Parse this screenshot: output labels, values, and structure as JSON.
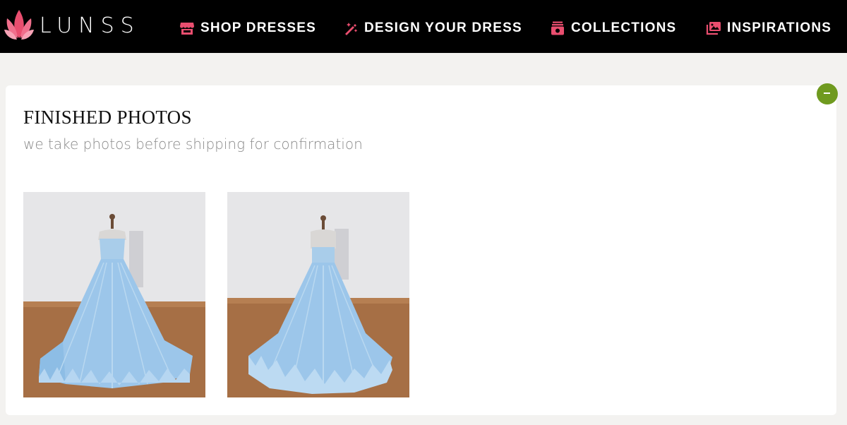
{
  "brand": {
    "name": "LUNSS",
    "logo_icon": "lotus-icon",
    "accent_color": "#e94e6f"
  },
  "nav": {
    "items": [
      {
        "label": "SHOP DRESSES",
        "icon": "store-icon"
      },
      {
        "label": "DESIGN YOUR DRESS",
        "icon": "magic-wand-icon"
      },
      {
        "label": "COLLECTIONS",
        "icon": "collection-box-icon"
      },
      {
        "label": "INSPIRATIONS",
        "icon": "photos-icon"
      }
    ]
  },
  "finished_photos": {
    "title": "FINISHED PHOTOS",
    "subtitle": "we take photos before shipping for confirmation",
    "photos": [
      {
        "alt": "front view",
        "dress_color": "#9cc8ec"
      },
      {
        "alt": "back view",
        "dress_color": "#9cc8ec"
      }
    ],
    "collapse_icon": "minus-icon",
    "collapse_color": "#6f9a1f"
  }
}
